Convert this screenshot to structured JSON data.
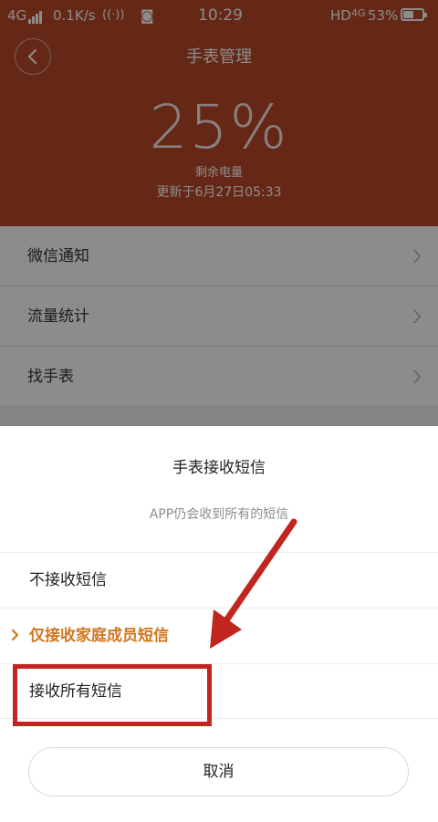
{
  "status_bar": {
    "network": "4G",
    "speed": "0.1K/s",
    "time": "10:29",
    "hd": "HD",
    "network_right": "4G",
    "battery_percent": "53%",
    "battery_level": 0.53
  },
  "header": {
    "title": "手表管理",
    "battery_value": "25%",
    "battery_label": "剩余电量",
    "updated": "更新于6月27日05:33"
  },
  "menu": [
    {
      "label": "微信通知"
    },
    {
      "label": "流量统计"
    },
    {
      "label": "找手表"
    }
  ],
  "sheet": {
    "title": "手表接收短信",
    "subtitle": "APP仍会收到所有的短信",
    "options": [
      {
        "label": "不接收短信",
        "selected": false
      },
      {
        "label": "仅接收家庭成员短信",
        "selected": true
      },
      {
        "label": "接收所有短信",
        "selected": false
      }
    ],
    "cancel_label": "取消"
  },
  "colors": {
    "header_bg": "#bb4a29",
    "selected_text": "#d0771f",
    "annotation_red": "#c0261f"
  }
}
